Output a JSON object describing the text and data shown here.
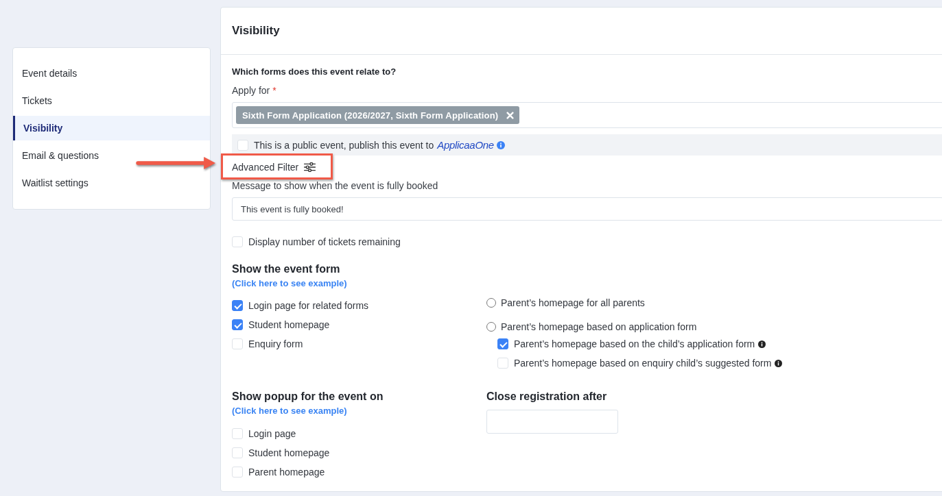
{
  "sidebar": {
    "items": [
      {
        "label": "Event details",
        "selected": false
      },
      {
        "label": "Tickets",
        "selected": false
      },
      {
        "label": "Visibility",
        "selected": true
      },
      {
        "label": "Email & questions",
        "selected": false
      },
      {
        "label": "Waitlist settings",
        "selected": false
      }
    ]
  },
  "panel": {
    "title": "Visibility",
    "forms_question": "Which forms does this event relate to?",
    "apply_for": {
      "label": "Apply for",
      "required_mark": "*",
      "tags": [
        {
          "label": "Sixth Form Application (2026/2027, Sixth Form Application)"
        }
      ]
    },
    "public_event": {
      "checked": false,
      "label": "This is a public event, publish this event to",
      "brand": "ApplicaaOne"
    },
    "advanced_filter": {
      "label": "Advanced Filter",
      "highlighted": true
    },
    "fully_booked_message": {
      "label": "Message to show when the event is fully booked",
      "value": "This event is fully booked!"
    },
    "display_remaining": {
      "label": "Display number of tickets remaining",
      "checked": false
    },
    "event_form": {
      "heading": "Show the event form",
      "link": "(Click here to see example)",
      "options": [
        {
          "label": "Login page for related forms",
          "checked": true
        },
        {
          "label": "Student homepage",
          "checked": true
        },
        {
          "label": "Enquiry form",
          "checked": false
        }
      ],
      "parent_options": [
        {
          "label": "Parent’s homepage for all parents",
          "selected": false
        },
        {
          "label": "Parent’s homepage based on application form",
          "selected": false,
          "children": [
            {
              "label": "Parent’s homepage based on the child’s application form",
              "checked": true,
              "info": true
            },
            {
              "label": "Parent’s homepage based on enquiry child’s suggested form",
              "checked": false,
              "info": true
            }
          ]
        }
      ]
    },
    "popup": {
      "heading": "Show popup for the event on",
      "link": "(Click here to see example)",
      "options": [
        {
          "label": "Login page",
          "checked": false
        },
        {
          "label": "Student homepage",
          "checked": false
        },
        {
          "label": "Parent homepage",
          "checked": false
        }
      ]
    },
    "close_registration": {
      "label": "Close registration after"
    }
  }
}
